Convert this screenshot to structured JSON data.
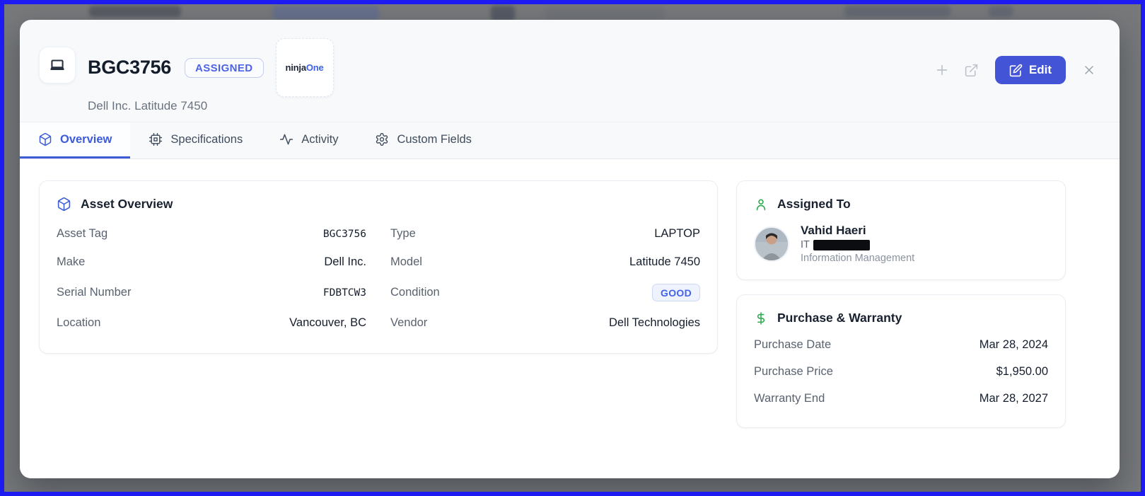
{
  "header": {
    "title": "BGC3756",
    "status_badge": "ASSIGNED",
    "subtitle": "Dell Inc. Latitude 7450",
    "logo": {
      "part1": "ninja",
      "part2": "One"
    },
    "edit_label": "Edit"
  },
  "tabs": [
    {
      "label": "Overview",
      "active": true
    },
    {
      "label": "Specifications",
      "active": false
    },
    {
      "label": "Activity",
      "active": false
    },
    {
      "label": "Custom Fields",
      "active": false
    }
  ],
  "asset_overview": {
    "title": "Asset Overview",
    "fields": [
      {
        "label": "Asset Tag",
        "value": "BGC3756"
      },
      {
        "label": "Type",
        "value": "LAPTOP"
      },
      {
        "label": "Make",
        "value": "Dell Inc."
      },
      {
        "label": "Model",
        "value": "Latitude 7450"
      },
      {
        "label": "Serial Number",
        "value": "FDBTCW3"
      },
      {
        "label": "Condition",
        "value": "GOOD"
      },
      {
        "label": "Location",
        "value": "Vancouver, BC"
      },
      {
        "label": "Vendor",
        "value": "Dell Technologies"
      }
    ]
  },
  "assigned_to": {
    "title": "Assigned To",
    "name": "Vahid Haeri",
    "role_prefix": "IT",
    "department": "Information Management"
  },
  "purchase_warranty": {
    "title": "Purchase & Warranty",
    "rows": [
      {
        "label": "Purchase Date",
        "value": "Mar 28, 2024"
      },
      {
        "label": "Purchase Price",
        "value": "$1,950.00"
      },
      {
        "label": "Warranty End",
        "value": "Mar 28, 2027"
      }
    ]
  },
  "colors": {
    "accent_blue": "#4355d6",
    "badge_blue": "#4263eb",
    "active_tab_blue": "#3b5bdb",
    "green_icon": "#2eac53",
    "backdrop_gray": "#77797b",
    "selection_border_blue": "#1d1bf2",
    "header_bg": "#f7f9fb",
    "card_border": "#e9edf2"
  }
}
